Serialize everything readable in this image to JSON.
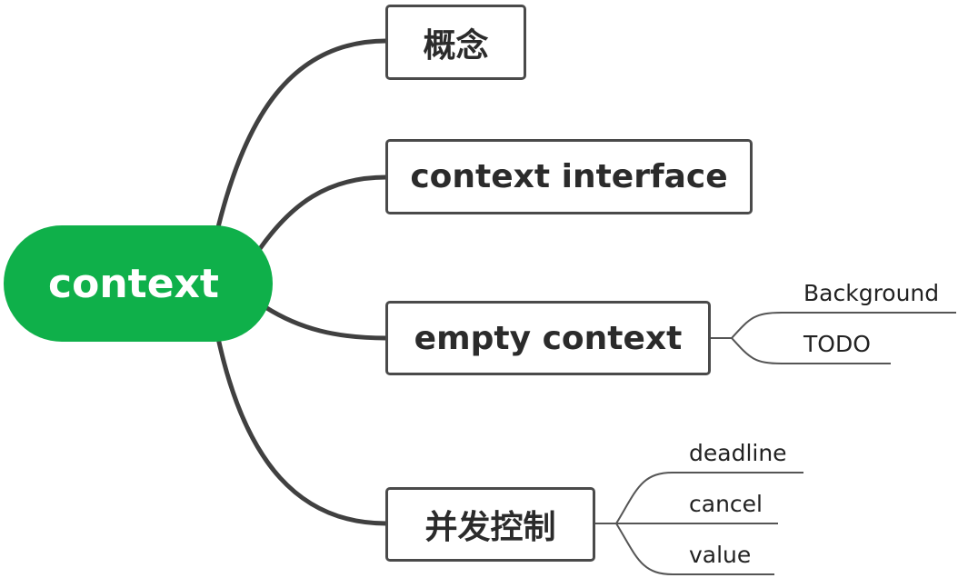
{
  "colors": {
    "central_fill": "#0fb04a",
    "branch_line": "#404040",
    "sub_line": "#555555"
  },
  "central": {
    "label": "context"
  },
  "topics": [
    {
      "label": "概念",
      "subtopics": []
    },
    {
      "label": "context interface",
      "subtopics": []
    },
    {
      "label": "empty context",
      "subtopics": [
        {
          "label": "Background"
        },
        {
          "label": "TODO"
        }
      ]
    },
    {
      "label": "并发控制",
      "subtopics": [
        {
          "label": "deadline"
        },
        {
          "label": "cancel"
        },
        {
          "label": "value"
        }
      ]
    }
  ]
}
